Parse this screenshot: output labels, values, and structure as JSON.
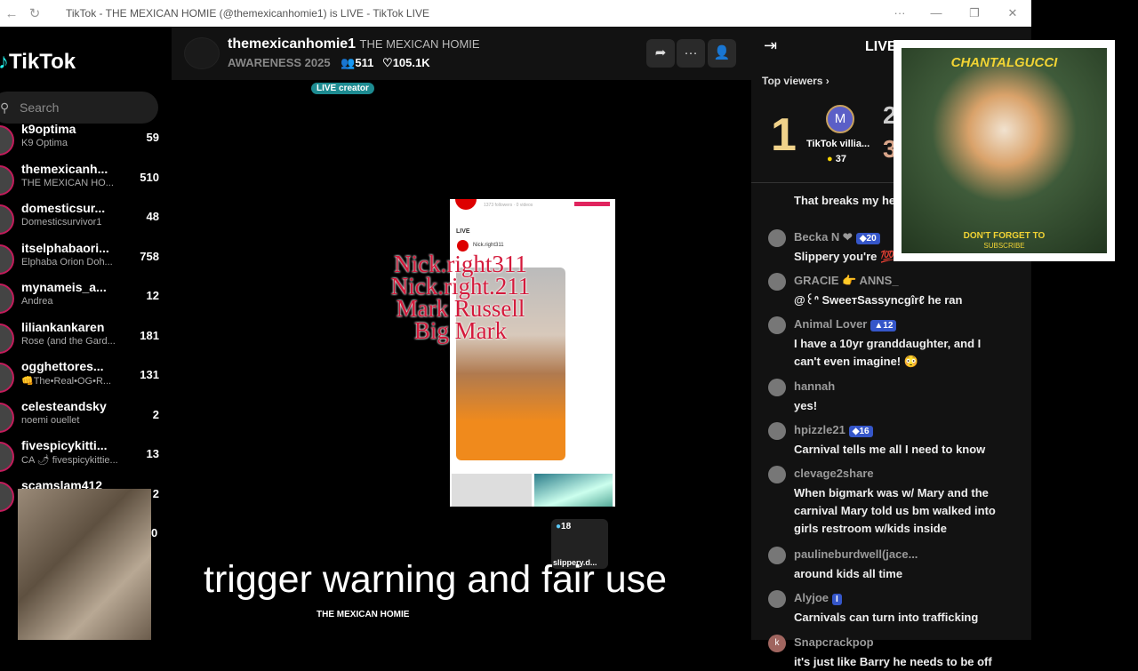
{
  "window": {
    "title": "TikTok - THE MEXICAN HOMIE (@themexicanhomie1) is LIVE - TikTok LIVE",
    "back": "←",
    "reload": "↻",
    "more": "···",
    "minimize": "—",
    "maximize": "❐",
    "close": "✕"
  },
  "sidebar": {
    "logo": "TikTok",
    "search_placeholder": "Search",
    "items": [
      {
        "name": "k9optima",
        "sub": "K9 Optima",
        "count": "59"
      },
      {
        "name": "themexicanh...",
        "sub": "THE MEXICAN HO...",
        "count": "510"
      },
      {
        "name": "domesticsur...",
        "sub": "Domesticsurvivor1",
        "count": "48"
      },
      {
        "name": "itselphabaori...",
        "sub": "Elphaba Orion Doh...",
        "count": "758"
      },
      {
        "name": "mynameis_a...",
        "sub": "Andrea",
        "count": "12"
      },
      {
        "name": "liliankankaren",
        "sub": "Rose (and the Gard...",
        "count": "181"
      },
      {
        "name": "ogghettores...",
        "sub": "👊The•Real•OG•R...",
        "count": "131"
      },
      {
        "name": "celesteandsky",
        "sub": "noemi ouellet",
        "count": "2"
      },
      {
        "name": "fivespicykitti...",
        "sub": "CA 🌶 fivespicykittie...",
        "count": "13"
      },
      {
        "name": "scamslam412",
        "sub": "",
        "count": "2"
      }
    ],
    "extra_count": "0"
  },
  "header": {
    "username": "themexicanhomie1",
    "display_name": "THE MEXICAN HOMIE",
    "title": "AWARENESS 2025",
    "viewers": "511",
    "likes": "105.1K",
    "share": "➦",
    "more": "···",
    "follow": "👤"
  },
  "video": {
    "badge": "LIVE creator",
    "overlay_lines": [
      "Nick.right311",
      "Nick.right.211",
      "Mark Russell",
      "Big Mark"
    ],
    "phone_live": "LIVE",
    "phone_user": "Nick.right311",
    "phone_followers": "1373 followers · 0 videos",
    "guest_count": "18",
    "guest_name": "slippery.d...",
    "caption": "trigger warning and fair use",
    "footer": "THE MEXICAN HOMIE"
  },
  "right": {
    "live_label": "LIVE",
    "top_viewers": "Top viewers",
    "rank1": "1",
    "rank2": "2",
    "rank3": "3",
    "viewer_initial": "M",
    "viewer_name": "TikTok villia...",
    "viewer_coins": "37",
    "comments": [
      {
        "user": "",
        "text": "That breaks my hea"
      },
      {
        "user": "Becka N ❤",
        "badge": "◆20",
        "text": "Slippery you're 💯"
      },
      {
        "user": "GRACIE 👉 ANNS_",
        "text": "@꒰ᐢ SweeтSassyncgîrℓ he ran"
      },
      {
        "user": "Animal Lover",
        "badge": "▲12",
        "text": "I have a 10yr granddaughter, and I can't even imagine! 😳"
      },
      {
        "user": "hannah",
        "text": "yes!"
      },
      {
        "user": "hpizzle21",
        "badge": "◆16",
        "text": "Carnival tells me all I need to know"
      },
      {
        "user": "clevage2share",
        "text": "When bigmark was w/ Mary and the carnival Mary told us bm walked into girls restroom w/kids inside"
      },
      {
        "user": "paulineburdwell(jace...",
        "text": "around kids all time"
      },
      {
        "user": "Alyjoe",
        "badge": "I",
        "text": "Carnivals can turn into trafficking"
      },
      {
        "user": "Snapcrackpop",
        "avatar": "k",
        "text": "it's just like Barry he needs to be off"
      }
    ]
  },
  "promo": {
    "brand": "CHANTALGUCCI",
    "line1": "DON'T FORGET TO",
    "line2": "SUBSCRIBE"
  },
  "colors": {
    "accent": "#fe2c55",
    "teal": "#1d8b91",
    "badge_blue": "#3556c9"
  }
}
